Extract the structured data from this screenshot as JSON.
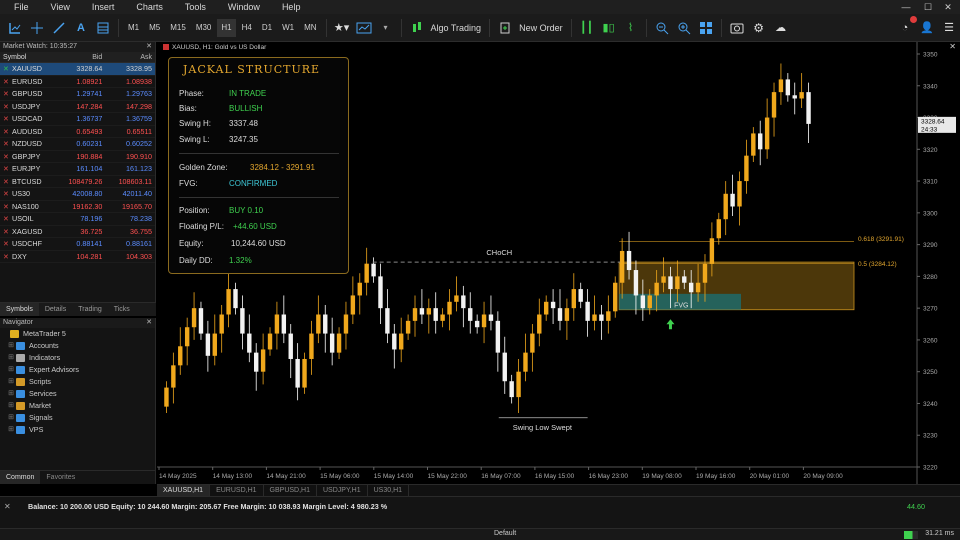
{
  "menu": [
    "File",
    "View",
    "Insert",
    "Charts",
    "Tools",
    "Window",
    "Help"
  ],
  "window_controls": [
    "—",
    "☐",
    "✕"
  ],
  "toolbar": {
    "timeframes": [
      "M1",
      "M5",
      "M15",
      "M30",
      "H1",
      "H4",
      "D1",
      "W1",
      "MN"
    ],
    "active_timeframe": "H1",
    "algo_label": "Algo Trading",
    "new_order_label": "New Order"
  },
  "market_watch": {
    "title": "Market Watch: 10:35:27",
    "close": "✕",
    "headers": [
      "Symbol",
      "Bid",
      "Ask"
    ],
    "rows": [
      {
        "sym": "XAUUSD",
        "bid": "3328.64",
        "ask": "3328.95",
        "up": true
      },
      {
        "sym": "EURUSD",
        "bid": "1.08921",
        "ask": "1.08938",
        "up": false
      },
      {
        "sym": "GBPUSD",
        "bid": "1.29741",
        "ask": "1.29763",
        "up": false
      },
      {
        "sym": "USDJPY",
        "bid": "147.284",
        "ask": "147.298",
        "up": false
      },
      {
        "sym": "USDCAD",
        "bid": "1.36737",
        "ask": "1.36759",
        "up": false
      },
      {
        "sym": "AUDUSD",
        "bid": "0.65493",
        "ask": "0.65511",
        "up": false
      },
      {
        "sym": "NZDUSD",
        "bid": "0.60231",
        "ask": "0.60252",
        "up": false
      },
      {
        "sym": "GBPJPY",
        "bid": "190.884",
        "ask": "190.910",
        "up": false
      },
      {
        "sym": "EURJPY",
        "bid": "161.104",
        "ask": "161.123",
        "up": false
      },
      {
        "sym": "BTCUSD",
        "bid": "108479.26",
        "ask": "108603.11",
        "up": false
      },
      {
        "sym": "US30",
        "bid": "42008.80",
        "ask": "42011.40",
        "up": false
      },
      {
        "sym": "NAS100",
        "bid": "19162.30",
        "ask": "19165.70",
        "up": false
      },
      {
        "sym": "USOIL",
        "bid": "78.196",
        "ask": "78.238",
        "up": false
      },
      {
        "sym": "XAGUSD",
        "bid": "36.725",
        "ask": "36.755",
        "up": false
      },
      {
        "sym": "USDCHF",
        "bid": "0.88141",
        "ask": "0.88161",
        "up": false
      },
      {
        "sym": "DXY",
        "bid": "104.281",
        "ask": "104.303",
        "up": false
      }
    ],
    "tabs": [
      "Symbols",
      "Details",
      "Trading",
      "Ticks"
    ]
  },
  "navigator": {
    "title": "Navigator",
    "close": "✕",
    "items": [
      {
        "label": "MetaTrader 5",
        "color": "#e0b020"
      },
      {
        "label": "Accounts",
        "color": "#3a8fe0"
      },
      {
        "label": "Indicators",
        "color": "#aaaaaa"
      },
      {
        "label": "Expert Advisors",
        "color": "#3a8fe0"
      },
      {
        "label": "Scripts",
        "color": "#d49a28"
      },
      {
        "label": "Services",
        "color": "#3a8fe0"
      },
      {
        "label": "Market",
        "color": "#d49a28"
      },
      {
        "label": "Signals",
        "color": "#3a8fe0"
      },
      {
        "label": "VPS",
        "color": "#3a8fe0"
      }
    ],
    "tabs": [
      "Common",
      "Favorites"
    ]
  },
  "chart": {
    "title": "XAUUSD, H1:  Gold vs US Dollar",
    "close": "✕",
    "tabs": [
      "XAUUSD,H1",
      "EURUSD,H1",
      "GBPUSD,H1",
      "USDJPY,H1",
      "US30,H1"
    ]
  },
  "panel": {
    "title": "JACKAL STRUCTURE",
    "phase_label": "Phase:",
    "phase": "IN TRADE",
    "bias_label": "Bias:",
    "bias": "BULLISH",
    "swingh_label": "Swing H:",
    "swingh": "3337.48",
    "swingl_label": "Swing L:",
    "swingl": "3247.35",
    "golden_label": "Golden Zone:",
    "golden": "3284.12 - 3291.91",
    "fvg_label": "FVG:",
    "fvg": "CONFIRMED",
    "position_label": "Position:",
    "position": "BUY 0.10",
    "floating_label": "Floating P/L:",
    "floating": "+44.60 USD",
    "equity_label": "Equity:",
    "equity": "10,244.60 USD",
    "dd_label": "Daily DD:",
    "dd": "1.32%"
  },
  "trade_box": {
    "balance_text": "Balance: 10 200.00 USD   Equity: 10 244.60   Margin: 205.67   Free Margin: 10 038.93   Margin Level: 4 980.23 %",
    "pl": "44.60"
  },
  "status": {
    "profile": "Default",
    "net": "31.21 ms"
  },
  "chart_data": {
    "type": "candlestick",
    "symbol": "XAUUSD",
    "timeframe": "H1",
    "ylim": [
      3220,
      3350
    ],
    "y_ticks": [
      3350,
      3340,
      3330,
      3320,
      3310,
      3300,
      3290,
      3280,
      3270,
      3260,
      3250,
      3240,
      3230,
      3220
    ],
    "x_ticks": [
      "14 May 2025",
      "14 May 13:00",
      "14 May 21:00",
      "15 May 06:00",
      "15 May 14:00",
      "15 May 22:00",
      "16 May 07:00",
      "16 May 15:00",
      "16 May 23:00",
      "19 May 08:00",
      "19 May 16:00",
      "20 May 01:00",
      "20 May 09:00"
    ],
    "current_price": "3328.64",
    "countdown": "24:33",
    "annotations": {
      "choch": "CHoCH",
      "choch_level": 3284.5,
      "swing_low": "Swing Low Swept",
      "swing_low_level": 3235.5,
      "fvg": "FVG",
      "fvg_range": [
        3269.5,
        3274.5
      ],
      "fib_0618": "0.618 (3291.91)",
      "fib_05": "0.5 (3284.12)",
      "golden_zone": [
        3269.5,
        3284.5
      ]
    },
    "closes": [
      3245,
      3252,
      3258,
      3264,
      3270,
      3262,
      3255,
      3262,
      3268,
      3276,
      3270,
      3262,
      3256,
      3250,
      3257,
      3262,
      3268,
      3262,
      3254,
      3245,
      3254,
      3262,
      3268,
      3262,
      3256,
      3262,
      3268,
      3274,
      3278,
      3284,
      3280,
      3270,
      3262,
      3257,
      3262,
      3266,
      3270,
      3268,
      3270,
      3266,
      3268,
      3272,
      3274,
      3270,
      3266,
      3264,
      3268,
      3266,
      3256,
      3247,
      3242,
      3250,
      3256,
      3262,
      3268,
      3272,
      3270,
      3266,
      3270,
      3276,
      3272,
      3266,
      3268,
      3266,
      3269,
      3278,
      3288,
      3282,
      3274,
      3270,
      3274,
      3278,
      3280,
      3276,
      3280,
      3278,
      3275,
      3278,
      3284,
      3292,
      3298,
      3306,
      3302,
      3310,
      3318,
      3325,
      3320,
      3330,
      3338,
      3342,
      3337,
      3336,
      3338,
      3328
    ]
  }
}
